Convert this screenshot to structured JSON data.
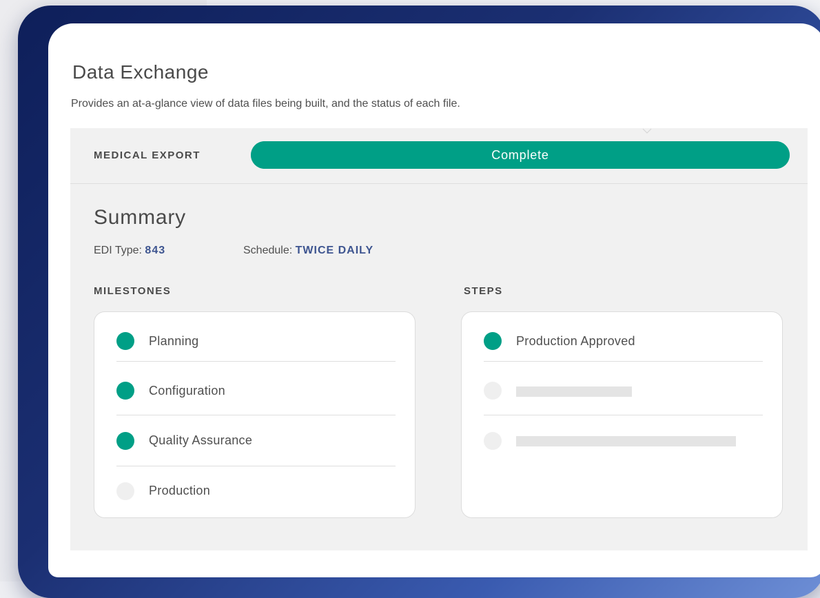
{
  "page": {
    "title": "Data Exchange",
    "description": "Provides an at-a-glance view of data files being built, and the status of each file."
  },
  "export": {
    "label": "MEDICAL EXPORT",
    "status": "Complete",
    "progress_percent": 100,
    "progress_color": "#009f86"
  },
  "summary": {
    "title": "Summary",
    "edi_type_label": "EDI Type:",
    "edi_type_value": "843",
    "schedule_label": "Schedule:",
    "schedule_value": "TWICE DAILY"
  },
  "milestones": {
    "heading": "MILESTONES",
    "items": [
      {
        "label": "Planning",
        "complete": true
      },
      {
        "label": "Configuration",
        "complete": true
      },
      {
        "label": "Quality Assurance",
        "complete": true
      },
      {
        "label": "Production",
        "complete": false
      }
    ]
  },
  "steps": {
    "heading": "STEPS",
    "items": [
      {
        "label": "Production Approved",
        "complete": true
      },
      {
        "label": "",
        "complete": false,
        "placeholder": true
      },
      {
        "label": "",
        "complete": false,
        "placeholder": true
      }
    ]
  },
  "colors": {
    "accent": "#009f86",
    "link": "#3e5590",
    "frame": "#1b2f72"
  },
  "icons": {
    "collapse": "chevron-down-icon",
    "status_complete": "check-dot-icon",
    "status_pending": "empty-dot-icon"
  }
}
